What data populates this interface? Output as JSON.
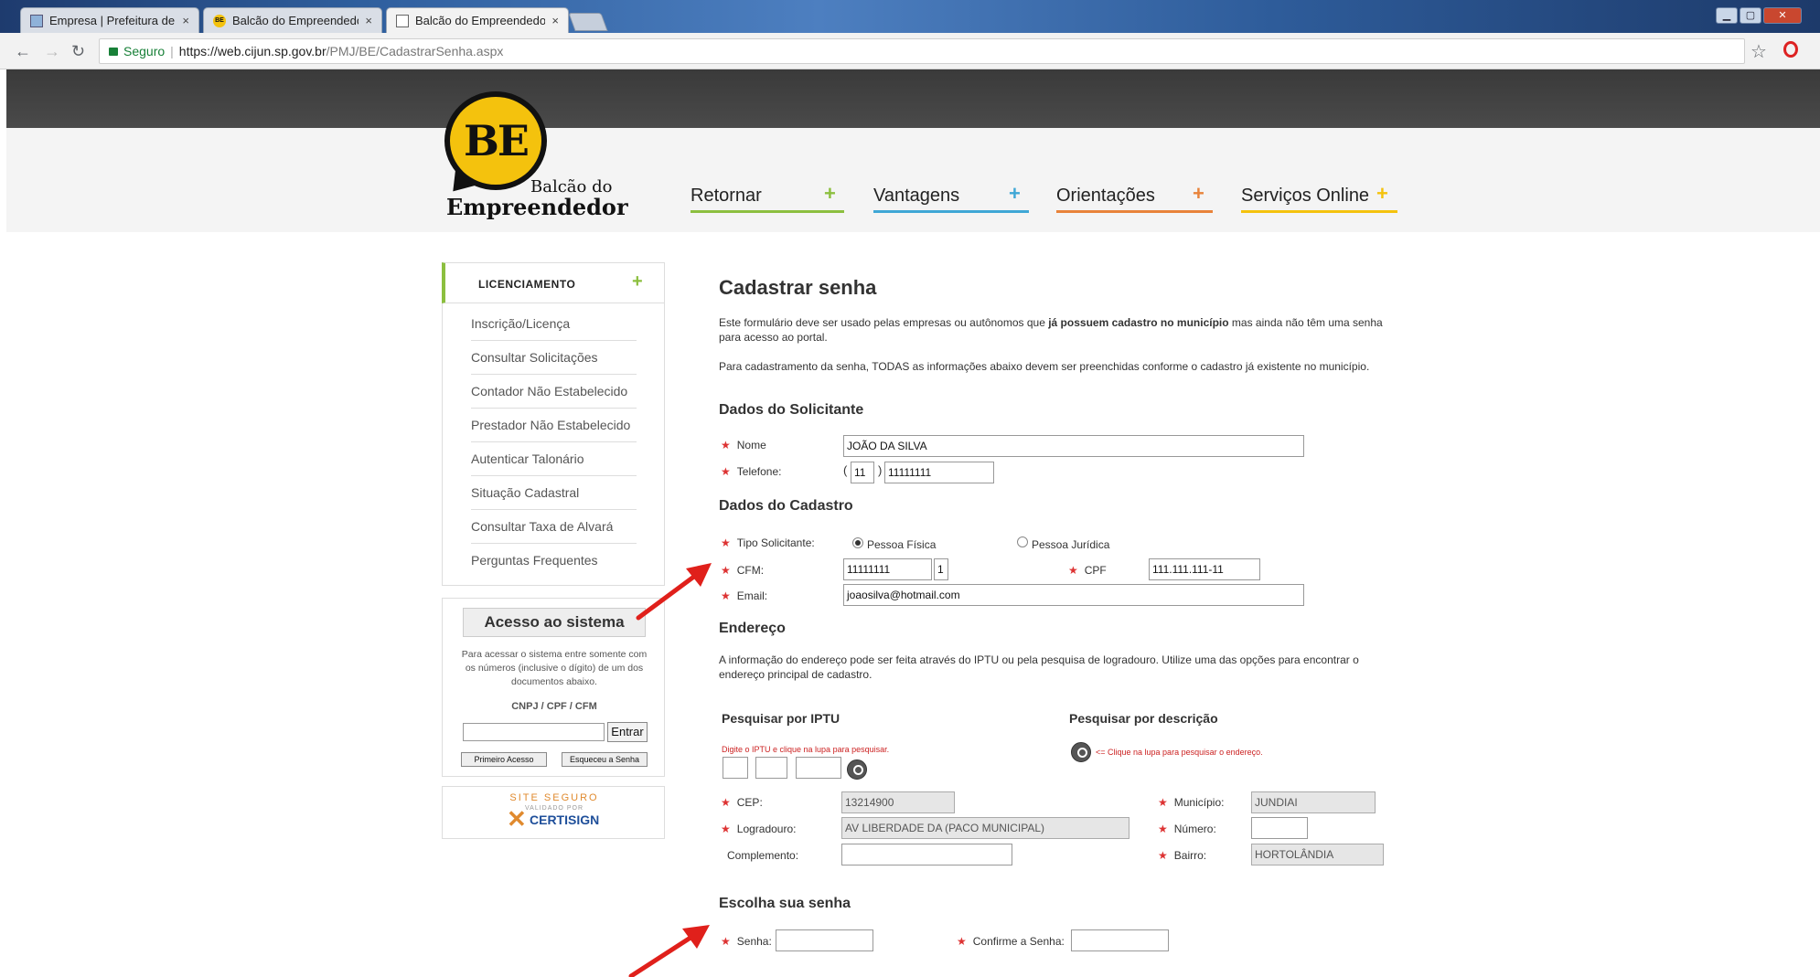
{
  "browser": {
    "tabs": [
      {
        "label": "Empresa | Prefeitura de J",
        "icon": "image-icon"
      },
      {
        "label": "Balcão do Empreendedor",
        "icon": "be-icon"
      },
      {
        "label": "Balcão do Empreendedor",
        "icon": "document-icon"
      }
    ],
    "close_glyph": "×",
    "secure_label": "Seguro",
    "url_host": "https://web.cijun.sp.gov.br",
    "url_path": "/PMJ/BE/CadastrarSenha.aspx"
  },
  "logo": {
    "badge": "BE",
    "line1": "Balcão do",
    "line2": "Empreendedor"
  },
  "topnav": [
    {
      "label": "Retornar",
      "color": "#8cbf3f"
    },
    {
      "label": "Vantagens",
      "color": "#3fa7d6"
    },
    {
      "label": "Orientações",
      "color": "#e8833a"
    },
    {
      "label": "Serviços Online",
      "color": "#f4c20d"
    }
  ],
  "plus_glyph": "+",
  "sidebar": {
    "header": "LICENCIAMENTO",
    "items": [
      "Inscrição/Licença",
      "Consultar Solicitações",
      "Contador Não Estabelecido",
      "Prestador Não Estabelecido",
      "Autenticar Talonário",
      "Situação Cadastral",
      "Consultar Taxa de Alvará",
      "Perguntas Frequentes"
    ]
  },
  "access": {
    "title": "Acesso ao sistema",
    "desc": "Para acessar o sistema entre somente com os números (inclusive o dígito) de um dos documentos abaixo.",
    "docs": "CNPJ / CPF / CFM",
    "enter": "Entrar",
    "first": "Primeiro Acesso",
    "forgot": "Esqueceu a Senha"
  },
  "seal": {
    "l1": "SITE SEGURO",
    "l2": "VALIDADO POR",
    "l3": "CERTISIGN"
  },
  "main": {
    "title": "Cadastrar senha",
    "intro_pre": "Este formulário deve ser usado pelas empresas ou autônomos que ",
    "intro_bold": "já possuem cadastro no município",
    "intro_post": " mas ainda não têm uma senha para acesso ao portal.",
    "intro2": "Para cadastramento da senha, TODAS as informações abaixo devem ser preenchidas conforme o cadastro já existente no município.",
    "sec_solicitante": "Dados do Solicitante",
    "nome_label": "Nome",
    "nome_value": "JOÃO DA SILVA",
    "telefone_label": "Telefone:",
    "ddd": "11",
    "phone": "11111111",
    "sec_cadastro": "Dados do Cadastro",
    "tipo_label": "Tipo Solicitante:",
    "pf": "Pessoa Física",
    "pj": "Pessoa Jurídica",
    "cfm_label": "CFM:",
    "cfm_value": "11111111",
    "cfm_dv": "1",
    "cpf_label": "CPF",
    "cpf_value": "111.111.111-11",
    "email_label": "Email:",
    "email_value": "joaosilva@hotmail.com",
    "sec_endereco": "Endereço",
    "endereco_desc": "A informação do endereço pode ser feita através do IPTU ou pela pesquisa de logradouro. Utilize uma das opções para encontrar o endereço principal de cadastro.",
    "iptu_title": "Pesquisar por IPTU",
    "iptu_hint": "Digite o IPTU e clique na lupa para pesquisar.",
    "desc_title": "Pesquisar por descrição",
    "desc_hint": "<= Clique na lupa para pesquisar o endereço.",
    "cep_label": "CEP:",
    "cep_value": "13214900",
    "municipio_label": "Município:",
    "municipio_value": "JUNDIAI",
    "logradouro_label": "Logradouro:",
    "logradouro_value": "AV  LIBERDADE DA (PACO MUNICIPAL)",
    "numero_label": "Número:",
    "complemento_label": "Complemento:",
    "bairro_label": "Bairro:",
    "bairro_value": "HORTOLÂNDIA",
    "sec_senha": "Escolha sua senha",
    "senha_label": "Senha:",
    "confirma_label": "Confirme a Senha:",
    "req": "★"
  },
  "colors": {
    "arrow": "#e0201b",
    "accent_green": "#8cbf3f",
    "logo_yellow": "#f4c20d"
  }
}
